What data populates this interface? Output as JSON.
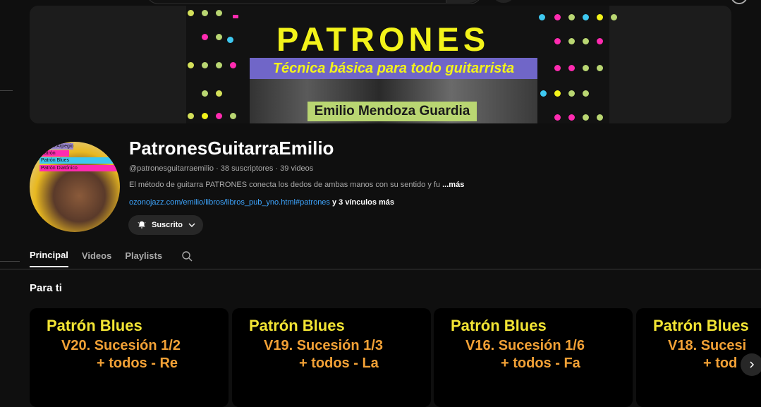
{
  "banner": {
    "title": "PATRONES",
    "subtitle": "Técnica básica para todo guitarrista",
    "author": "Emilio Mendoza Guardia"
  },
  "avatar_strips": [
    "Patrón Arpegio",
    "Patrón",
    "Patrón Blues",
    "Patrón Diatónico"
  ],
  "channel": {
    "name": "PatronesGuitarraEmilio",
    "handle": "@patronesguitarraemilio",
    "sep1": " · ",
    "subscribers": "38 suscriptores",
    "sep2": " · ",
    "videos": "39 videos",
    "description": "El método de guitarra PATRONES conecta los dedos de ambas manos con su sentido y fu",
    "more_label": "...más",
    "link": "ozonojazz.com/emilio/libros/libros_pub_yno.html#patrones",
    "extra_links": " y 3 vínculos más"
  },
  "subscribe_button": {
    "label": "Suscrito",
    "icon": "bell-icon"
  },
  "tabs": [
    {
      "label": "Principal",
      "active": true
    },
    {
      "label": "Videos",
      "active": false
    },
    {
      "label": "Playlists",
      "active": false
    }
  ],
  "section_title": "Para ti",
  "videos": [
    {
      "line1": "Patrón Blues",
      "line2": "V20. Sucesión 1/2",
      "line3": "+ todos - Re"
    },
    {
      "line1": "Patrón Blues",
      "line2": "V19. Sucesión 1/3",
      "line3": "+ todos - La"
    },
    {
      "line1": "Patrón Blues",
      "line2": "V16. Sucesión 1/6",
      "line3": "+ todos - Fa"
    },
    {
      "line1": "Patrón Blues",
      "line2": "V18. Sucesi",
      "line3": "+ tod"
    }
  ],
  "colors": {
    "background": "#0f0f0f",
    "link": "#3ea6ff",
    "banner_title": "#f3f31a",
    "banner_sub_bg": "#7066c8",
    "card_title": "#f3e534",
    "card_sub": "#f2a136"
  }
}
